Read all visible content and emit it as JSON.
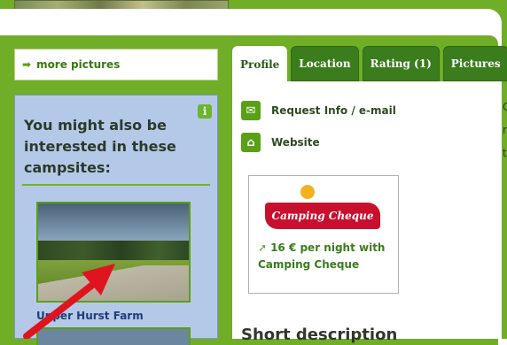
{
  "top_photo": {
    "name": "campsite-photo"
  },
  "sidebar": {
    "more_pictures": "more pictures",
    "suggest_title": "You might also be interested in these campsites:",
    "suggested": [
      {
        "name": "Upper Hurst Farm"
      }
    ]
  },
  "tabs": [
    {
      "label": "Profile",
      "active": true
    },
    {
      "label": "Location",
      "active": false
    },
    {
      "label": "Rating (1)",
      "active": false
    },
    {
      "label": "Pictures",
      "active": false
    }
  ],
  "content": {
    "request_info": "Request Info / e-mail",
    "website": "Website",
    "camping_cheque": {
      "logo_text": "Camping Cheque",
      "price_text": "16 € per night with Camping Cheque"
    },
    "short_description_heading": "Short description",
    "edge_chars": [
      "C",
      "r",
      "t"
    ]
  },
  "colors": {
    "frame_green": "#6fae26",
    "tab_green": "#3b7d1d",
    "sidebar_blue": "#b4c9e8",
    "link_blue": "#1e3e7a",
    "arrow_red": "#e0141e"
  },
  "icons": {
    "more_pictures_arrow": "arrow-right-icon",
    "info": "info-icon",
    "email": "envelope-icon",
    "website": "home-icon",
    "price_arrow": "arrow-right-icon"
  }
}
